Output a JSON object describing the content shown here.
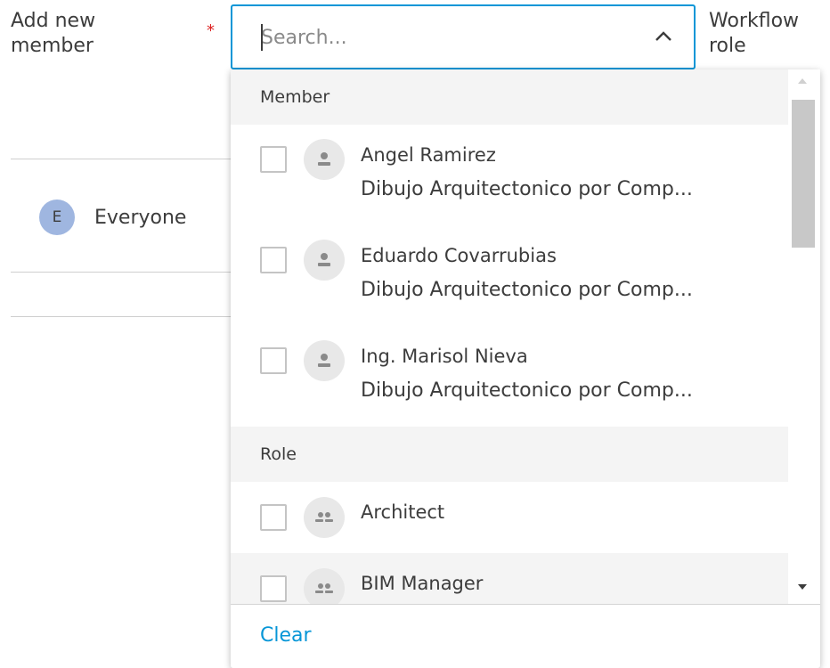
{
  "form": {
    "label": "Add new member",
    "required_mark": "*",
    "workflow_label": "Workflow role"
  },
  "search": {
    "placeholder": "Search..."
  },
  "background": {
    "everyone": {
      "avatar_letter": "E",
      "label": "Everyone"
    }
  },
  "dropdown": {
    "member_header": "Member",
    "members": [
      {
        "name": "Angel Ramirez",
        "company": "Dibujo Arquitectonico por Comp..."
      },
      {
        "name": "Eduardo Covarrubias",
        "company": "Dibujo Arquitectonico por Comp..."
      },
      {
        "name": "Ing. Marisol Nieva",
        "company": "Dibujo Arquitectonico por Comp..."
      }
    ],
    "role_header": "Role",
    "roles": [
      {
        "name": "Architect"
      },
      {
        "name": "BIM Manager"
      }
    ],
    "clear_label": "Clear"
  },
  "colors": {
    "accent": "#0696d7",
    "required": "#dd2222",
    "everyone_avatar": "#9fb6e0"
  }
}
